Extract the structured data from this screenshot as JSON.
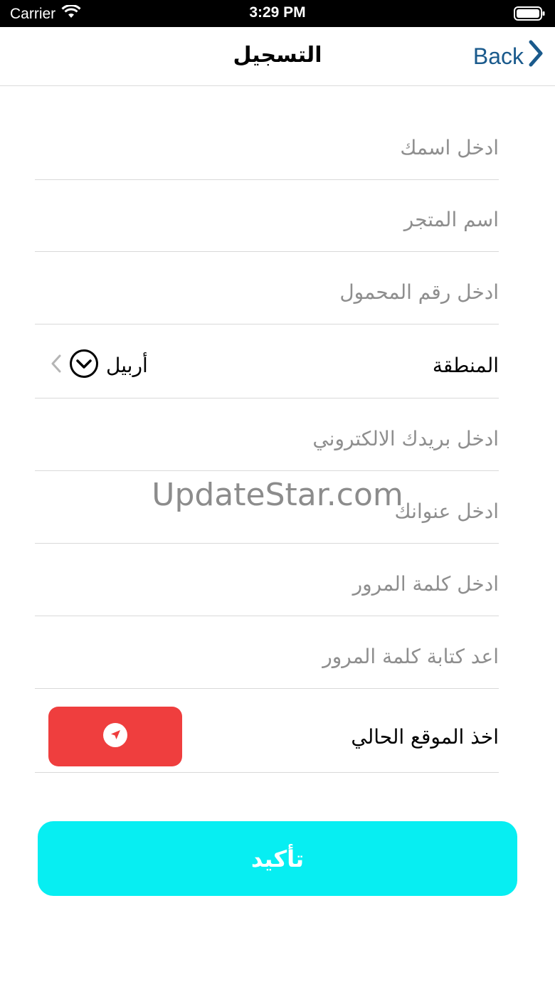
{
  "status_bar": {
    "carrier": "Carrier",
    "time": "3:29 PM"
  },
  "nav": {
    "title": "التسجيل",
    "back_label": "Back"
  },
  "form": {
    "name_placeholder": "ادخل اسمك",
    "store_placeholder": "اسم المتجر",
    "phone_placeholder": "ادخل رقم المحمول",
    "region_label": "المنطقة",
    "region_value": "أربيل",
    "email_placeholder": "ادخل بريدك الالكتروني",
    "address_placeholder": "ادخل عنوانك",
    "password_placeholder": "ادخل كلمة المرور",
    "password_confirm_placeholder": "اعد كتابة كلمة المرور",
    "location_label": "اخذ الموقع الحالي"
  },
  "confirm_label": "تأكيد",
  "watermark": "UpdateStar.com",
  "colors": {
    "accent": "#07eef2",
    "location_button": "#ef3e3e",
    "back_link": "#1a5a8c"
  }
}
